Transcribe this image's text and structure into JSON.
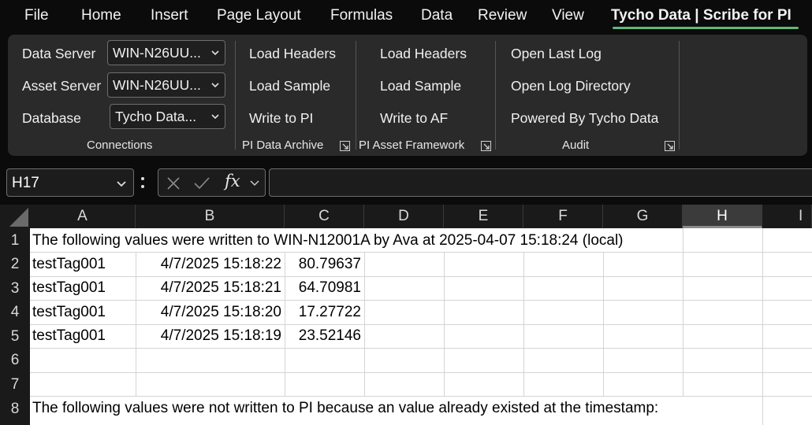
{
  "tabs": [
    {
      "label": "File"
    },
    {
      "label": "Home"
    },
    {
      "label": "Insert"
    },
    {
      "label": "Page Layout"
    },
    {
      "label": "Formulas"
    },
    {
      "label": "Data"
    },
    {
      "label": "Review"
    },
    {
      "label": "View"
    },
    {
      "label": "Tycho Data | Scribe for PI",
      "active": true
    }
  ],
  "ribbon": {
    "connections": {
      "data_server_label": "Data Server",
      "data_server_value": "WIN-N26UU...",
      "asset_server_label": "Asset Server",
      "asset_server_value": "WIN-N26UU...",
      "database_label": "Database",
      "database_value": "Tycho Data...",
      "group_label": "Connections"
    },
    "pi_data_archive": {
      "load_headers": "Load Headers",
      "load_sample": "Load Sample",
      "write": "Write to PI",
      "group_label": "PI Data Archive"
    },
    "pi_asset_framework": {
      "load_headers": "Load Headers",
      "load_sample": "Load Sample",
      "write": "Write to AF",
      "group_label": "PI Asset Framework"
    },
    "audit": {
      "open_last_log": "Open Last Log",
      "open_log_directory": "Open Log Directory",
      "powered_by": "Powered By Tycho Data",
      "group_label": "Audit"
    }
  },
  "formula_bar": {
    "name_box": "H17",
    "fx": "fx",
    "formula": ""
  },
  "grid": {
    "selected_column": "H",
    "columns": [
      "A",
      "B",
      "C",
      "D",
      "E",
      "F",
      "G",
      "H",
      "I"
    ],
    "rows": [
      "1",
      "2",
      "3",
      "4",
      "5",
      "6",
      "7",
      "8"
    ],
    "cells": {
      "A1": "The following values were written to WIN-N12001A by Ava at 2025-04-07 15:18:24 (local)",
      "A2": "testTag001",
      "B2": "4/7/2025 15:18:22",
      "C2": "80.79637",
      "A3": "testTag001",
      "B3": "4/7/2025 15:18:21",
      "C3": "64.70981",
      "A4": "testTag001",
      "B4": "4/7/2025 15:18:20",
      "C4": "17.27722",
      "A5": "testTag001",
      "B5": "4/7/2025 15:18:19",
      "C5": "23.52146",
      "A8": "The following values were not written to PI because an value already existed at the timestamp:"
    }
  }
}
